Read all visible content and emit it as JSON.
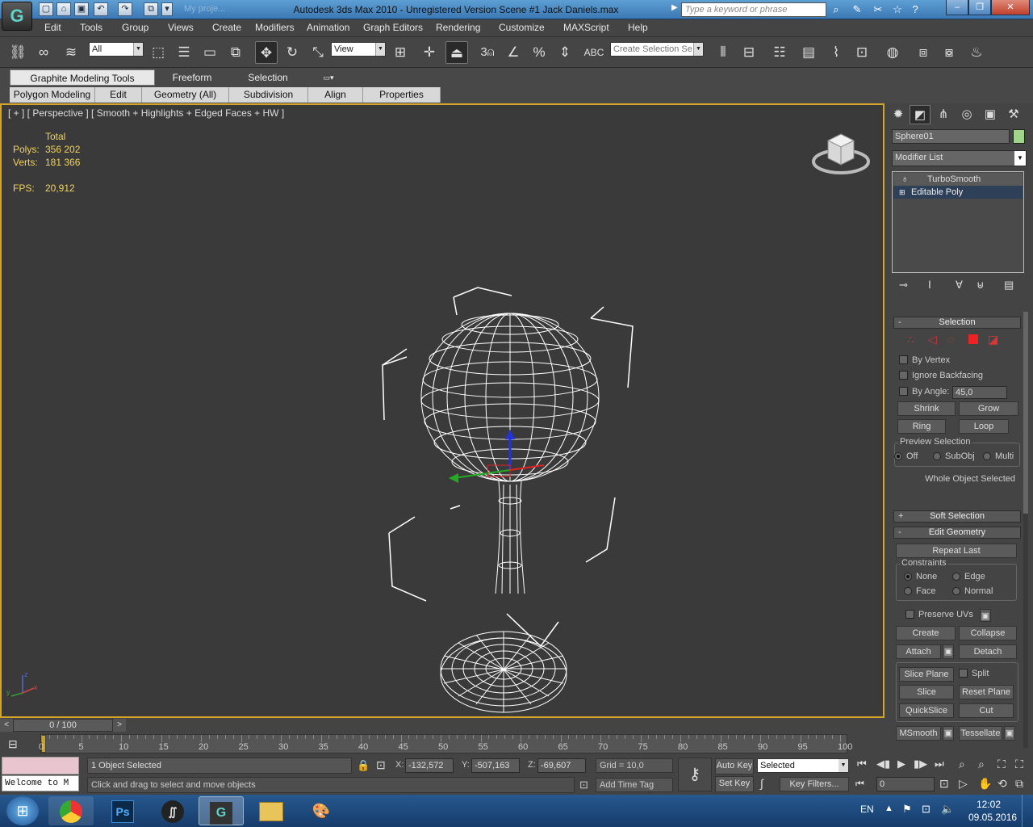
{
  "app": {
    "title": "Autodesk 3ds Max  2010   -  Unregistered Version      Scene #1 Jack Daniels.max",
    "search_placeholder": "Type a keyword or phrase",
    "project_field": "My proje..."
  },
  "menu": [
    "Edit",
    "Tools",
    "Group",
    "Views",
    "Create",
    "Modifiers",
    "Animation",
    "Graph Editors",
    "Rendering",
    "Customize",
    "MAXScript",
    "Help"
  ],
  "toolbar": {
    "filter_value": "All",
    "ref_coord_value": "View",
    "named_selection_placeholder": "Create Selection Se",
    "snap_numbers": {
      "snap": "3",
      "percent": "%"
    }
  },
  "ribbon": {
    "tabs": [
      "Graphite Modeling Tools",
      "Freeform",
      "Selection"
    ],
    "subtabs": [
      "Polygon Modeling",
      "Edit",
      "Geometry (All)",
      "Subdivision",
      "Align",
      "Properties"
    ]
  },
  "viewport": {
    "label": "[ + ] [ Perspective ] [ Smooth + Highlights + Edged Faces + HW ]",
    "stats": {
      "header": "Total",
      "polys_label": "Polys:",
      "polys": "356 202",
      "verts_label": "Verts:",
      "verts": "181 366",
      "fps_label": "FPS:",
      "fps": "20,912"
    }
  },
  "command_panel": {
    "object_name": "Sphere01",
    "object_color": "#9fd68a",
    "modifier_list": "Modifier List",
    "stack": [
      "TurboSmooth",
      "Editable Poly"
    ],
    "selection": {
      "title": "Selection",
      "by_vertex": "By Vertex",
      "ignore_backfacing": "Ignore Backfacing",
      "by_angle": "By Angle:",
      "angle_value": "45,0",
      "shrink": "Shrink",
      "grow": "Grow",
      "ring": "Ring",
      "loop": "Loop",
      "preview_title": "Preview Selection",
      "preview_options": [
        "Off",
        "SubObj",
        "Multi"
      ],
      "status": "Whole Object Selected"
    },
    "soft_selection": "Soft Selection",
    "edit_geometry": {
      "title": "Edit Geometry",
      "repeat_last": "Repeat Last",
      "constraints_title": "Constraints",
      "constraints": [
        "None",
        "Edge",
        "Face",
        "Normal"
      ],
      "preserve_uvs": "Preserve UVs",
      "create": "Create",
      "collapse": "Collapse",
      "attach": "Attach",
      "detach": "Detach",
      "slice_plane": "Slice Plane",
      "split": "Split",
      "slice": "Slice",
      "reset_plane": "Reset Plane",
      "quickslice": "QuickSlice",
      "cut": "Cut",
      "msmooth": "MSmooth",
      "tessellate": "Tessellate"
    }
  },
  "timeline": {
    "frame_counter": "0 / 100",
    "ticks": [
      "0",
      "5",
      "10",
      "15",
      "20",
      "25",
      "30",
      "35",
      "40",
      "45",
      "50",
      "55",
      "60",
      "65",
      "70",
      "75",
      "80",
      "85",
      "90",
      "95",
      "100"
    ]
  },
  "status": {
    "maxscript_text": "Welcome to M",
    "selection_info": "1 Object Selected",
    "prompt": "Click and drag to select and move objects",
    "x_label": "X:",
    "x": "-132,572",
    "y_label": "Y:",
    "y": "-507,163",
    "z_label": "Z:",
    "z": "-69,607",
    "grid": "Grid = 10,0",
    "add_time_tag": "Add Time Tag",
    "auto_key": "Auto Key",
    "set_key": "Set Key",
    "key_mode": "Selected",
    "key_filters": "Key Filters...",
    "frame_value": "0"
  },
  "taskbar": {
    "language": "EN",
    "time": "12:02",
    "date": "09.05.2016",
    "apps": [
      "chrome",
      "photoshop",
      "unreal",
      "3dsmax",
      "explorer",
      "paint"
    ]
  }
}
